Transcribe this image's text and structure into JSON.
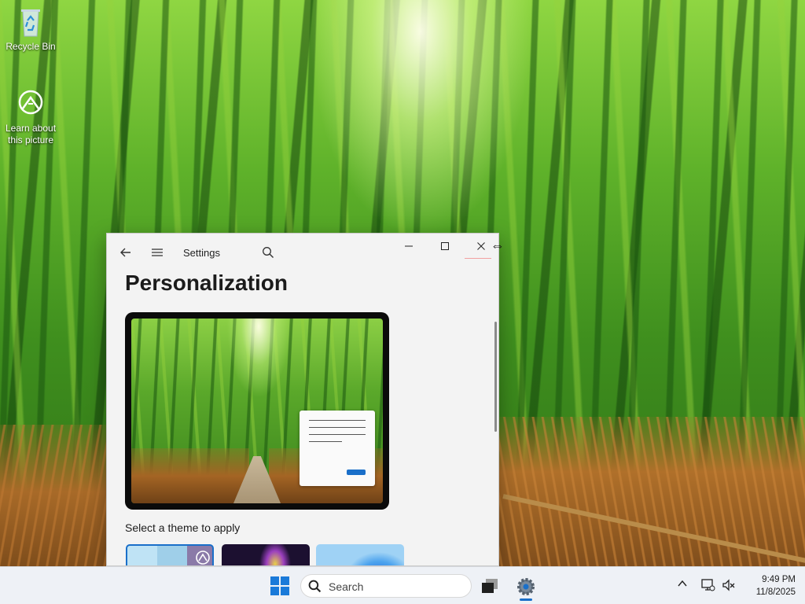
{
  "desktop": {
    "icons": [
      {
        "label": "Recycle Bin"
      },
      {
        "label": "Learn about this picture"
      }
    ]
  },
  "window": {
    "title": "Settings",
    "page_title": "Personalization",
    "section_label": "Select a theme to apply"
  },
  "taskbar": {
    "search_placeholder": "Search",
    "time": "9:49 PM",
    "date": "11/8/2025"
  },
  "icons": {
    "back": "back-arrow-icon",
    "menu": "hamburger-menu-icon",
    "search": "search-icon",
    "minimize": "minimize-icon",
    "maximize": "maximize-icon",
    "close": "close-icon",
    "start": "windows-logo-icon",
    "settings": "gear-icon"
  },
  "colors": {
    "accent": "#1a6fc9",
    "window_bg": "#f3f3f3",
    "taskbar_bg": "#eef1f6"
  }
}
